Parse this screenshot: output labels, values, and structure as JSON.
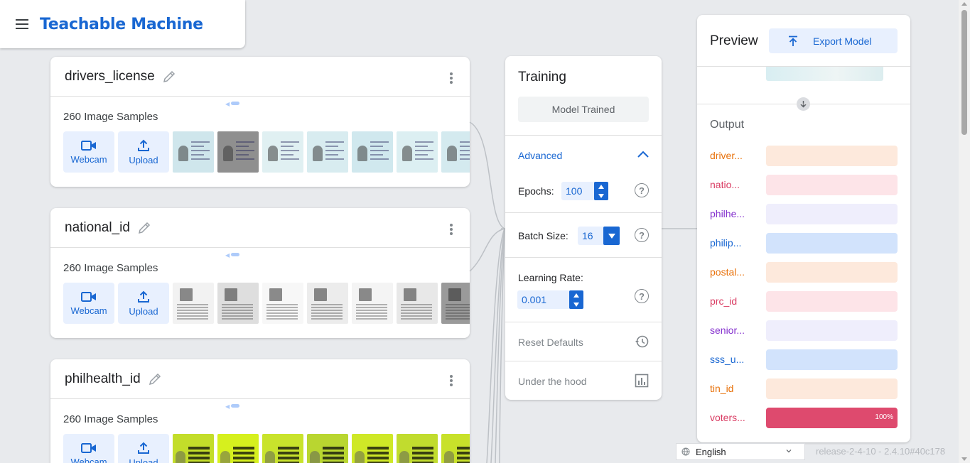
{
  "app": {
    "title": "Teachable Machine",
    "menu_icon": "hamburger-menu-icon"
  },
  "classes": [
    {
      "name": "drivers_license",
      "samples": "260 Image Samples",
      "webcam_label": "Webcam",
      "upload_label": "Upload",
      "thumb_style": "id-card"
    },
    {
      "name": "national_id",
      "samples": "260 Image Samples",
      "webcam_label": "Webcam",
      "upload_label": "Upload",
      "thumb_style": "document"
    },
    {
      "name": "philhealth_id",
      "samples": "260 Image Samples",
      "webcam_label": "Webcam",
      "upload_label": "Upload",
      "thumb_style": "green-card"
    }
  ],
  "training": {
    "title": "Training",
    "status_button": "Model Trained",
    "advanced_label": "Advanced",
    "epochs_label": "Epochs:",
    "epochs_value": "100",
    "batch_label": "Batch Size:",
    "batch_value": "16",
    "lr_label": "Learning Rate:",
    "lr_value": "0.001",
    "reset_label": "Reset Defaults",
    "hood_label": "Under the hood",
    "help_glyph": "?"
  },
  "preview": {
    "title": "Preview",
    "export_label": "Export Model",
    "output_title": "Output",
    "outputs": [
      {
        "label": "driver...",
        "color": "#e8710a",
        "bg": "#fde9dc",
        "value": 0
      },
      {
        "label": "natio...",
        "color": "#d93b62",
        "bg": "#fde4e8",
        "value": 0
      },
      {
        "label": "philhe...",
        "color": "#8430ce",
        "bg": "#efeefc",
        "value": 0
      },
      {
        "label": "philip...",
        "color": "#1967d2",
        "bg": "#d2e3fc",
        "value": 0
      },
      {
        "label": "postal...",
        "color": "#e8710a",
        "bg": "#fde9dc",
        "value": 0
      },
      {
        "label": "prc_id",
        "color": "#d93b62",
        "bg": "#fde4e8",
        "value": 0
      },
      {
        "label": "senior...",
        "color": "#8430ce",
        "bg": "#efeefc",
        "value": 0
      },
      {
        "label": "sss_u...",
        "color": "#1967d2",
        "bg": "#d2e3fc",
        "value": 0
      },
      {
        "label": "tin_id",
        "color": "#e8710a",
        "bg": "#fde9dc",
        "value": 0
      },
      {
        "label": "voters...",
        "color": "#d93b62",
        "bg": "#fde4e8",
        "fill": "#de4a6e",
        "value": 100,
        "pct": "100%"
      }
    ]
  },
  "footer": {
    "language": "English",
    "release": "release-2-4-10 - 2.4.10#40c178"
  }
}
